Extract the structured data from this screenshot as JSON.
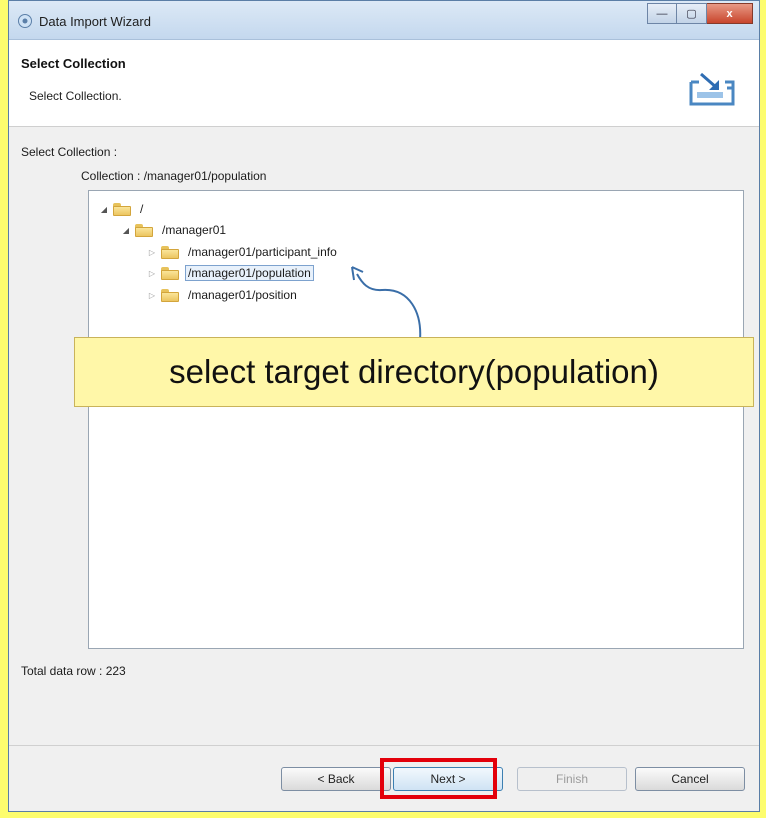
{
  "window": {
    "title": "Data Import Wizard",
    "controls": {
      "minimize": "—",
      "maximize": "▢",
      "close": "x"
    }
  },
  "header": {
    "title": "Select Collection",
    "description": "Select Collection.",
    "icon": "import-icon"
  },
  "body": {
    "select_label": "Select Collection :",
    "collection_path": "Collection : /manager01/population",
    "tree": [
      {
        "label": "/",
        "expanded": true,
        "level": 0
      },
      {
        "label": "/manager01",
        "expanded": true,
        "level": 1
      },
      {
        "label": "/manager01/participant_info",
        "expanded": false,
        "level": 2
      },
      {
        "label": "/manager01/population",
        "expanded": false,
        "level": 2,
        "selected": true
      },
      {
        "label": "/manager01/position",
        "expanded": false,
        "level": 2
      }
    ],
    "total_rows": "Total data row : 223"
  },
  "annotation": {
    "callout": "select target directory(population)"
  },
  "buttons": {
    "back": "< Back",
    "next": "Next >",
    "finish": "Finish",
    "cancel": "Cancel"
  },
  "colors": {
    "background": "#fdfd6e",
    "callout": "#fff7a8",
    "highlight": "#e3000b",
    "arrow": "#3a6ea8"
  }
}
